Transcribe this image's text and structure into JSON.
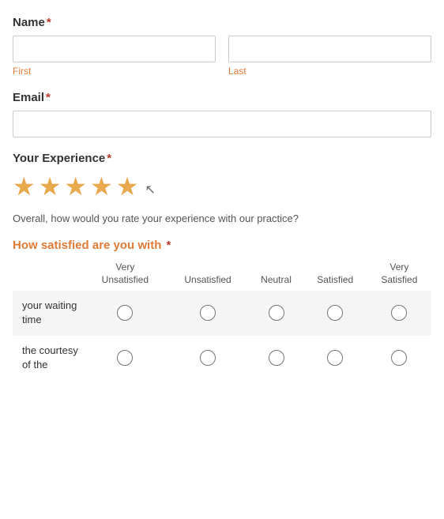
{
  "form": {
    "name_label": "Name",
    "required_marker": "*",
    "first_label": "First",
    "last_label": "Last",
    "email_label": "Email",
    "experience_label": "Your Experience",
    "stars_filled": 5,
    "stars_total": 5,
    "experience_note": "Overall, how would you rate your experience with our practice?",
    "satisfaction_title": "How satisfied are you with",
    "satisfaction_columns": [
      "Very Unsatisfied",
      "Unsatisfied",
      "Neutral",
      "Satisfied",
      "Very Satisfied"
    ],
    "satisfaction_rows": [
      {
        "label": "your waiting time"
      },
      {
        "label": "the courtesy of the"
      }
    ]
  }
}
